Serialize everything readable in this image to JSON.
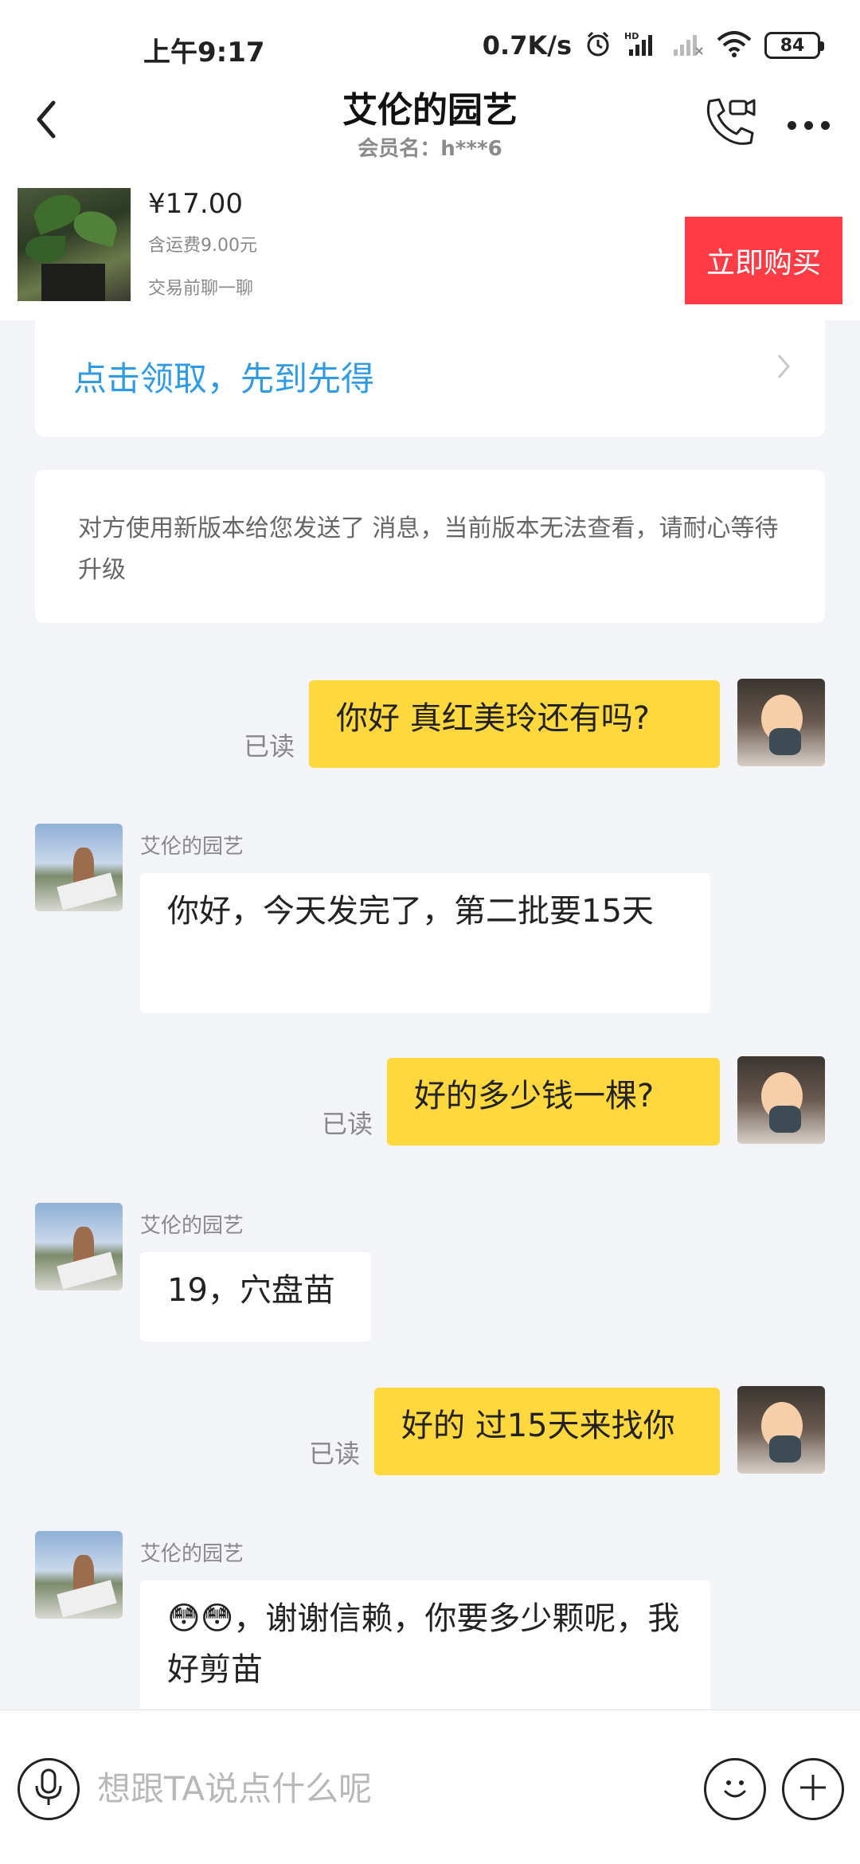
{
  "status_bar": {
    "time": "上午9:17",
    "net_speed": "0.7K/s",
    "battery": "84",
    "icons": [
      "alarm-icon",
      "hd-signal-icon",
      "signal-icon",
      "wifi-icon",
      "battery-icon"
    ]
  },
  "header": {
    "title": "艾伦的园艺",
    "subtitle": "会员名：h***6",
    "icons": [
      "back-arrow-icon",
      "video-call-icon",
      "more-icon"
    ]
  },
  "product": {
    "price": "¥17.00",
    "shipping": "含运费9.00元",
    "chat_hint": "交易前聊一聊",
    "buy_label": "立即购买"
  },
  "chat": {
    "coupon_text": "点击领取，先到先得",
    "notice_text": "对方使用新版本给您发送了 消息，当前版本无法查看，请耐心等待升级",
    "read_label": "已读",
    "sender_name": "艾伦的园艺",
    "messages": [
      {
        "direction": "out",
        "text": "你好 真红美玲还有吗?",
        "status": "已读"
      },
      {
        "direction": "in",
        "sender": "艾伦的园艺",
        "text": "你好，今天发完了，第二批要15天"
      },
      {
        "direction": "out",
        "text": "好的多少钱一棵?",
        "status": "已读"
      },
      {
        "direction": "in",
        "sender": "艾伦的园艺",
        "text": "19，穴盘苗"
      },
      {
        "direction": "out",
        "text": "好的 过15天来找你",
        "status": "已读"
      },
      {
        "direction": "in",
        "sender": "艾伦的园艺",
        "text": "😳😳，谢谢信赖，你要多少颗呢，我好剪苗"
      }
    ]
  },
  "input_bar": {
    "placeholder": "想跟TA说点什么呢",
    "icons": [
      "microphone-icon",
      "emoji-icon",
      "plus-icon"
    ]
  },
  "colors": {
    "accent_red": "#ff3b45",
    "bubble_yellow": "#ffd83d",
    "link_blue": "#2f9be6",
    "background": "#f3f4f8"
  }
}
